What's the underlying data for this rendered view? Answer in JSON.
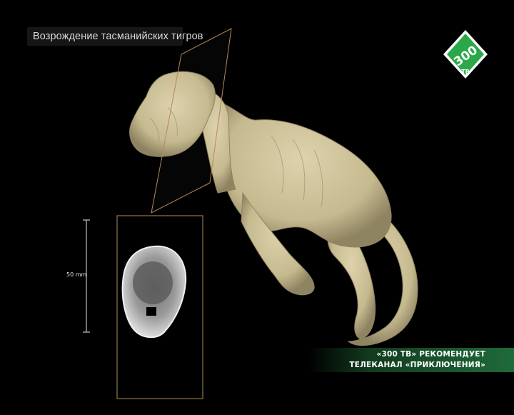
{
  "broadcast": {
    "program_caption": "Возрождение тасманийских тигров",
    "channel_logo_text": "300",
    "channel_logo_sub": "ТВ",
    "ticker_line1": "«300 ТВ» РЕКОМЕНДУЕТ",
    "ticker_line2": "ТЕЛЕКАНАЛ «ПРИКЛЮЧЕНИЯ»"
  },
  "scan": {
    "scale_label": "50 mm"
  },
  "colors": {
    "background": "#000000",
    "specimen": "#cfc39a",
    "specimen_shadow": "#8f8462",
    "slice_frame": "#b38a5a",
    "logo_green": "#2aa84a",
    "ticker_green": "#1f6b3a"
  },
  "icons": {
    "channel_logo": "channel-logo-icon"
  }
}
